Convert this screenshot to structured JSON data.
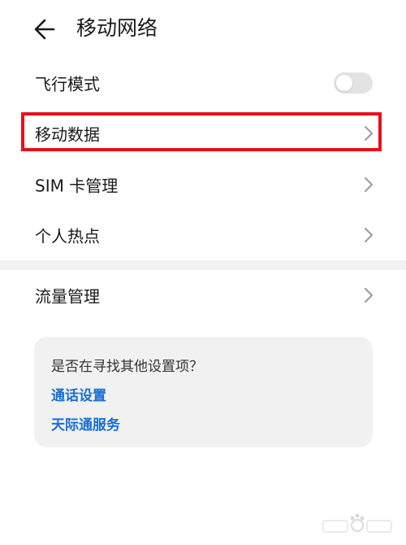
{
  "header": {
    "title": "移动网络",
    "back_icon": "arrow-left-icon"
  },
  "settings": {
    "airplane_mode": {
      "label": "飞行模式",
      "enabled": false
    },
    "mobile_data": {
      "label": "移动数据"
    },
    "sim_management": {
      "label": "SIM 卡管理"
    },
    "hotspot": {
      "label": "个人热点"
    },
    "data_usage": {
      "label": "流量管理"
    }
  },
  "suggestions": {
    "question": "是否在寻找其他设置项？",
    "links": [
      "通话设置",
      "天际通服务"
    ]
  },
  "colors": {
    "highlight": "#e8101b",
    "link": "#1a6fd1",
    "card_bg": "#f1f1f1",
    "toggle_off": "#e3e3e3"
  }
}
